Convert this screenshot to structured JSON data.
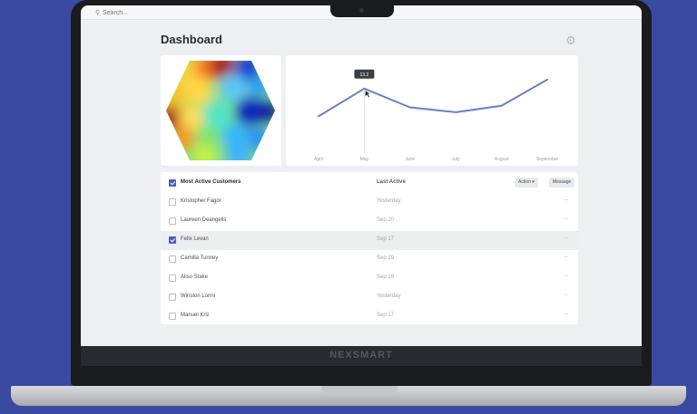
{
  "brand": "NEXSMART",
  "search": {
    "placeholder": "Search..."
  },
  "page": {
    "title": "Dashboard"
  },
  "colors": {
    "background": "#3a4aa3",
    "accent": "#4a5ec0",
    "line": "#6b7fc6"
  },
  "icons": {
    "search": "search-icon",
    "settings": "gear-icon",
    "more": "more-icon"
  },
  "chart_data": {
    "type": "line",
    "categories": [
      "April",
      "May",
      "June",
      "July",
      "August",
      "September"
    ],
    "values": [
      34,
      68,
      45,
      39,
      47,
      79
    ],
    "ylim": [
      0,
      100
    ],
    "tooltip": {
      "category": "May",
      "value": "13.2"
    },
    "grid": false
  },
  "table": {
    "header": {
      "name": "Most Active Customers",
      "last_active": "Last Active",
      "action_label": "Action",
      "message_label": "Message"
    },
    "rows": [
      {
        "name": "Kristopher Fagor",
        "date": "Yesterday",
        "checked": false
      },
      {
        "name": "Laureen Deangelis",
        "date": "Sep 20",
        "checked": false
      },
      {
        "name": "Felix Levan",
        "date": "Sep 17",
        "checked": true
      },
      {
        "name": "Camilla Tunney",
        "date": "Sep 19",
        "checked": false
      },
      {
        "name": "Aliso Stake",
        "date": "Sep 19",
        "checked": false
      },
      {
        "name": "Winston Lonni",
        "date": "Yesterday",
        "checked": false
      },
      {
        "name": "Manuel Kriz",
        "date": "Sep 17",
        "checked": false
      }
    ]
  }
}
